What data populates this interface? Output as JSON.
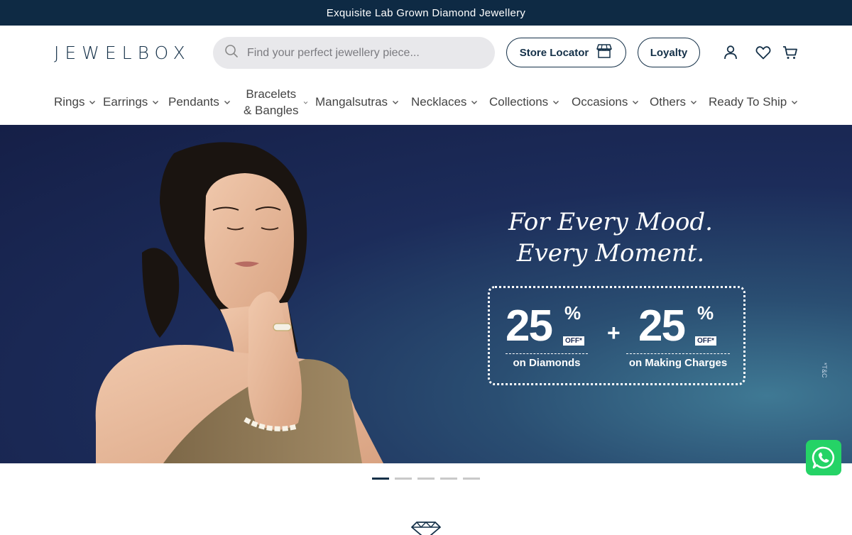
{
  "announcement": "Exquisite Lab Grown Diamond Jewellery",
  "logo": "JEWELBOX",
  "search": {
    "placeholder": "Find your perfect jewellery piece..."
  },
  "header_buttons": {
    "store_locator": "Store Locator",
    "loyalty": "Loyalty"
  },
  "header_icons": [
    "account-icon",
    "wishlist-heart-icon",
    "cart-icon"
  ],
  "nav": [
    {
      "label": "Rings"
    },
    {
      "label": "Earrings"
    },
    {
      "label": "Pendants"
    },
    {
      "label_line1": "Bracelets",
      "label_line2": "& Bangles"
    },
    {
      "label": "Mangalsutras"
    },
    {
      "label": "Necklaces"
    },
    {
      "label": "Collections"
    },
    {
      "label": "Occasions"
    },
    {
      "label": "Others"
    },
    {
      "label": "Ready To Ship"
    }
  ],
  "hero": {
    "headline_line1": "For Every Mood.",
    "headline_line2": "Every Moment.",
    "offer1": {
      "value": "25",
      "symbol": "%",
      "off": "OFF*",
      "label": "on Diamonds"
    },
    "plus": "+",
    "offer2": {
      "value": "25",
      "symbol": "%",
      "off": "OFF*",
      "label": "on Making Charges"
    },
    "tc": "*T&C"
  },
  "carousel": {
    "slides": 5,
    "active": 1
  },
  "colors": {
    "brand": "#143048",
    "announce_bg": "#0e2a44",
    "hero_bg": "#1c2c5a",
    "whatsapp": "#25d366"
  }
}
